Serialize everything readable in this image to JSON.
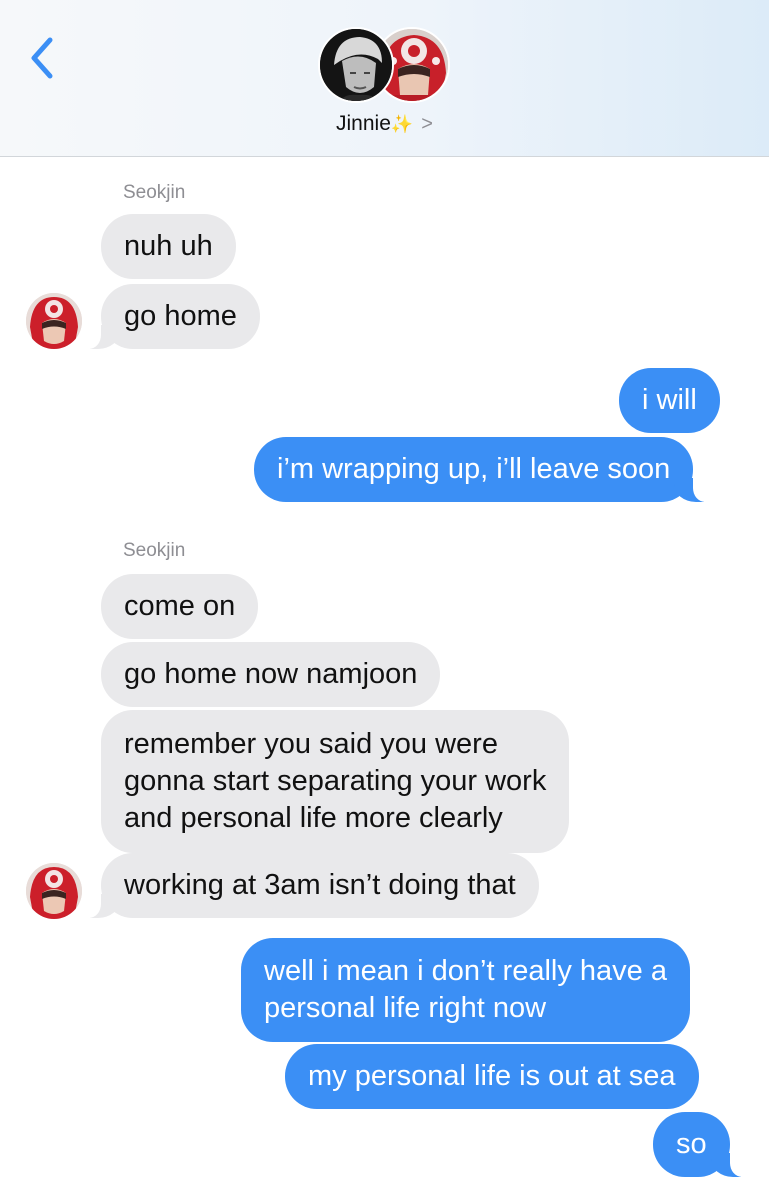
{
  "header": {
    "contact_name": "Jinnie",
    "contact_emoji": "✨",
    "chevron": ">",
    "back_icon": "chevron-left-icon",
    "accent_color": "#3b8ff5"
  },
  "messages": {
    "group1_sender": "Seokjin",
    "m1": "nuh uh",
    "m2": "go home",
    "m3": "i will",
    "m4": "i’m wrapping up, i’ll leave soon",
    "group2_sender": "Seokjin",
    "m5": "come on",
    "m6": "go home now namjoon",
    "m7_l1": "remember you said you were",
    "m7_l2": "gonna start separating your work",
    "m7_l3": "and personal life more clearly",
    "m8": "working at 3am isn’t doing that",
    "m9_l1": "well i mean i don’t really have a",
    "m9_l2": "personal life right now",
    "m10": "my personal life is out at sea",
    "m11": "so"
  },
  "colors": {
    "incoming_bubble": "#e9e9eb",
    "outgoing_bubble": "#3b8ff5"
  }
}
